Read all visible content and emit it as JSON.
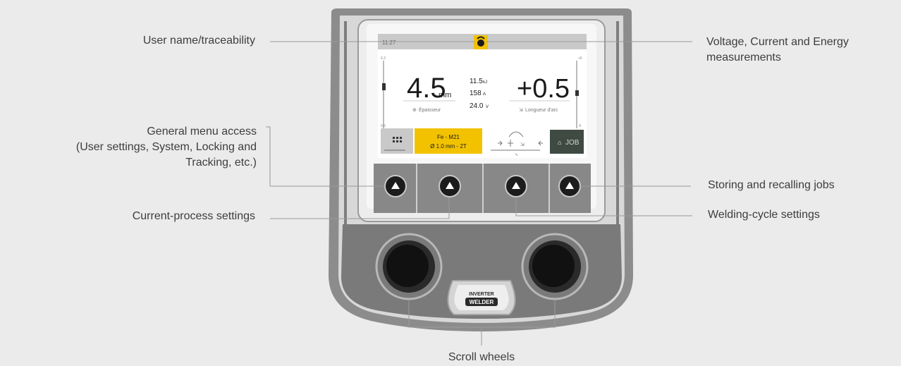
{
  "callouts": {
    "user_name": "User name/traceability",
    "measurements": "Voltage, Current and Energy measurements",
    "general_menu": [
      "General menu access",
      "(User settings, System, Locking and",
      "Tracking, etc.)"
    ],
    "current_process": "Current-process settings",
    "storing_jobs": "Storing and recalling jobs",
    "welding_cycle": "Welding-cycle settings",
    "scroll_wheels": "Scroll wheels"
  },
  "screen": {
    "time": "11:27",
    "left_scale_top": "6.3",
    "left_scale_bottom": "0.6",
    "right_scale_top": "+5",
    "right_scale_bottom": "-5",
    "thickness_value": "4.5",
    "thickness_unit": "mm",
    "thickness_label": "Épaisseur",
    "meas_energy": "11.5",
    "meas_energy_unit": "kJ",
    "meas_current": "158",
    "meas_current_unit": "A",
    "meas_voltage": "24.0",
    "meas_voltage_unit": "V",
    "arc_value": "+0.5",
    "arc_label": "Longueur d'arc",
    "material_line1": "Fe - M21",
    "material_line2": "Ø 1.0 mm - 2T",
    "job_label": "JOB"
  },
  "badge": {
    "line1": "INVERTER",
    "line2": "WELDER"
  },
  "colors": {
    "background": "#ebebeb",
    "housing_outer": "#8a8a8a",
    "housing_light": "#d6d6d6",
    "accent_yellow": "#f2c200",
    "job_button": "#3f4a42"
  }
}
